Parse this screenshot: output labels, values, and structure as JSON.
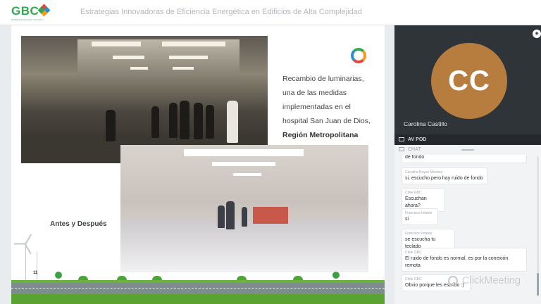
{
  "header": {
    "logo_text": "GBC",
    "logo_sub": "GREEN BUILDING COUNCIL",
    "title": "Estrategias Innovadoras de Eficiencia Energética en Edificios de Alta Complejidad",
    "logo_colors": [
      "#e2453c",
      "#2fa84f",
      "#2b8fd4",
      "#f39c1f"
    ]
  },
  "slide": {
    "caption_lines": [
      "Recambio de luminarias,",
      "una de las medidas",
      "implementadas en el",
      "hospital San Juan de Dios,"
    ],
    "caption_bold": "Región Metropolitana",
    "before_after": "Antes y Después",
    "page_number": "11"
  },
  "video": {
    "initials": "CC",
    "name": "Carolina Castillo",
    "avatar_color": "#b77d3f"
  },
  "panel": {
    "av_pod": "AV POD",
    "chat": "CHAT"
  },
  "chat_messages": [
    {
      "author": "",
      "text": "de fondo"
    },
    {
      "author": "Carolina Reyes Morales",
      "text": "si, escucho pero hay ruido de fondo"
    },
    {
      "author": "Chile GBC",
      "text": "Escuchan ahora?"
    },
    {
      "author": "Francisco Infante",
      "text": "si"
    },
    {
      "author": "Francisco Infante",
      "text": "se escucha tu teclado"
    },
    {
      "author": "Chile GBC",
      "text": "El ruido de fondo es normal, es por la conexión remota"
    },
    {
      "author": "Chile GBC",
      "text": "Obvio porque les escribo :)"
    }
  ],
  "watermark": "ClickMeeting"
}
